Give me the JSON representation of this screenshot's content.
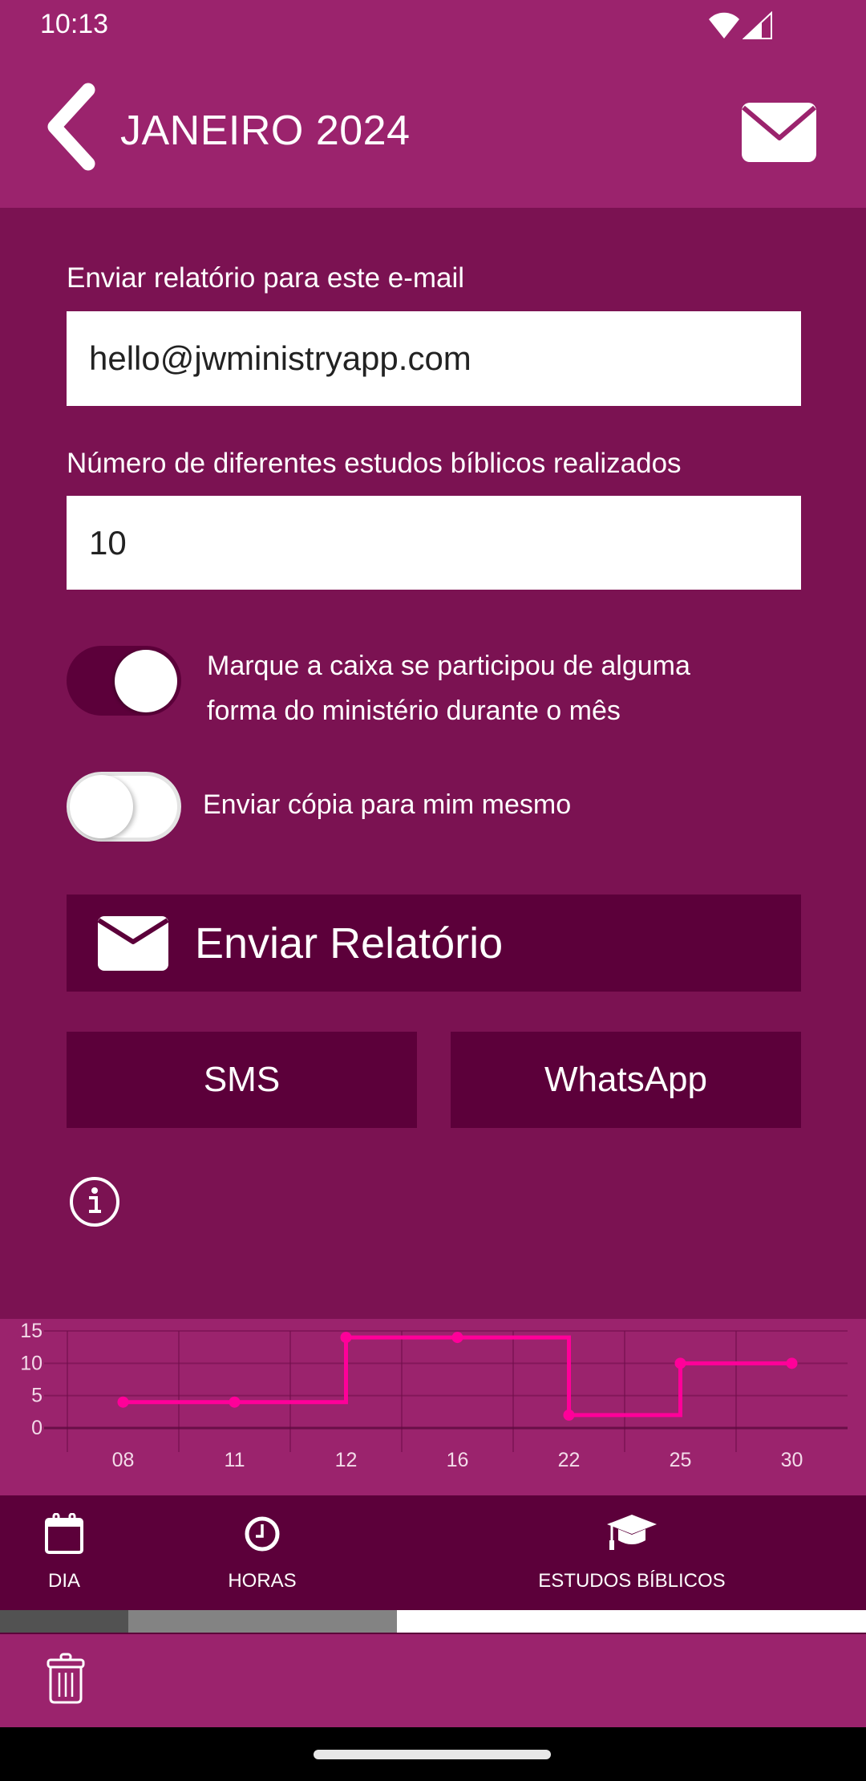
{
  "status_bar": {
    "time": "10:13",
    "icons": [
      "wifi-icon",
      "signal-icon"
    ]
  },
  "header": {
    "back_icon": "chevron-left-icon",
    "title": "JANEIRO 2024",
    "action_icon": "envelope-icon"
  },
  "form": {
    "email_label": "Enviar relatório para este e-mail",
    "email_value": "hello@jwministryapp.com",
    "studies_label": "Número de diferentes estudos bíblicos realizados",
    "studies_value": "10",
    "participated_toggle": {
      "label_lines": [
        "Marque a caixa se participou de alguma",
        "forma do ministério durante o mês"
      ],
      "checked": true
    },
    "copy_toggle": {
      "label": "Enviar cópia para mim mesmo",
      "checked": false
    },
    "send_button": {
      "label": "Enviar Relatório",
      "icon": "envelope-icon"
    },
    "sms_button": {
      "label": "SMS"
    },
    "whatsapp_button": {
      "label": "WhatsApp"
    },
    "info_icon": "info-icon"
  },
  "chart_data": {
    "type": "line",
    "style": "step",
    "title": "",
    "xlabel": "",
    "ylabel": "",
    "categories": [
      "08",
      "11",
      "12",
      "16",
      "22",
      "25",
      "30"
    ],
    "values": [
      4,
      4,
      14,
      14,
      2,
      10,
      10
    ],
    "yticks": [
      0,
      5,
      10,
      15
    ],
    "ylim": [
      0,
      15
    ],
    "grid": true,
    "legend": "none",
    "line_color": "#FF0099"
  },
  "bottom_nav": {
    "items": [
      {
        "label": "DIA",
        "icon": "calendar-icon"
      },
      {
        "label": "HORAS",
        "icon": "clock-icon"
      },
      {
        "label": "ESTUDOS BÍBLICOS",
        "icon": "graduation-cap-icon"
      }
    ]
  },
  "indicator_strip": {
    "segments": [
      {
        "fraction": 0.148,
        "color": "#525252"
      },
      {
        "fraction": 0.31,
        "color": "#838383"
      },
      {
        "fraction": 0.542,
        "color": "#FFFFFF"
      }
    ]
  },
  "footer": {
    "delete_icon": "trash-icon"
  },
  "colors": {
    "header": "#9B236D",
    "background": "#7B1252",
    "button": "#5C003A",
    "chart_line": "#FF0099"
  }
}
